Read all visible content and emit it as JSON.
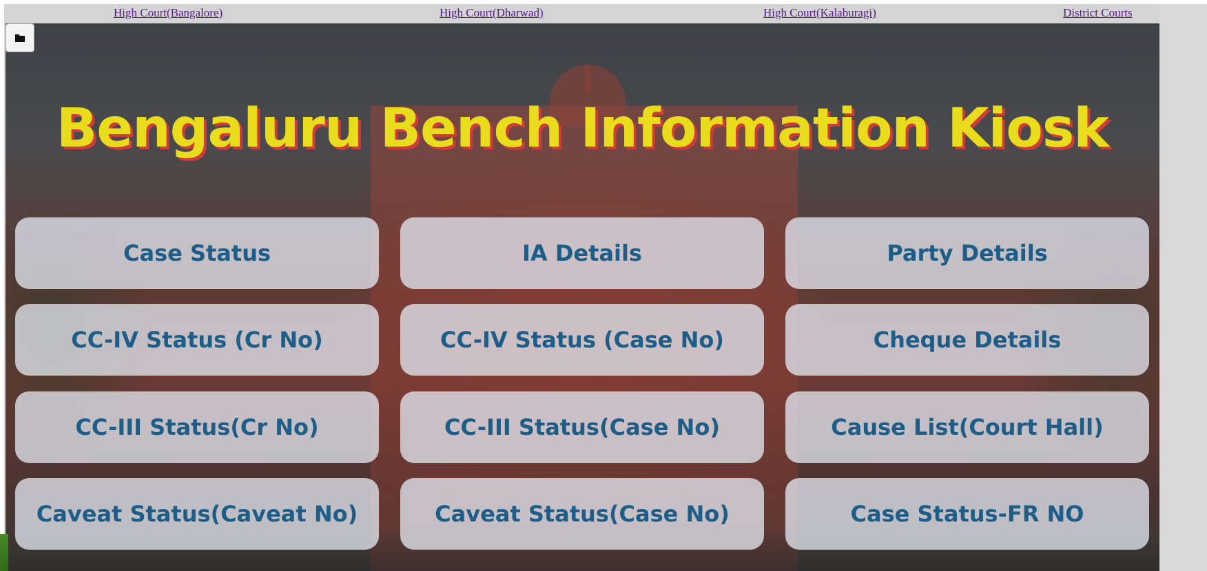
{
  "top_links": [
    {
      "label": "High Court(Bangalore)"
    },
    {
      "label": "High Court(Dharwad)"
    },
    {
      "label": "High Court(Kalaburagi)"
    },
    {
      "label": "District Courts"
    }
  ],
  "kiosk": {
    "title": "Bengaluru Bench Information Kiosk",
    "folder_icon": "folder-icon",
    "buttons": [
      {
        "label": "Case Status"
      },
      {
        "label": "IA Details"
      },
      {
        "label": "Party Details"
      },
      {
        "label": "CC-IV Status (Cr No)"
      },
      {
        "label": "CC-IV Status (Case No)"
      },
      {
        "label": "Cheque Details"
      },
      {
        "label": "CC-III Status(Cr No)"
      },
      {
        "label": "CC-III Status(Case No)"
      },
      {
        "label": "Cause List(Court Hall)"
      },
      {
        "label": "Caveat Status(Caveat No)"
      },
      {
        "label": "Caveat Status(Case No)"
      },
      {
        "label": "Case Status-FR NO"
      }
    ]
  },
  "colors": {
    "title_fill": "#e8dc1c",
    "title_shadow": "#d23b3b",
    "button_text": "#1d5d88",
    "link": "#551a8b"
  }
}
